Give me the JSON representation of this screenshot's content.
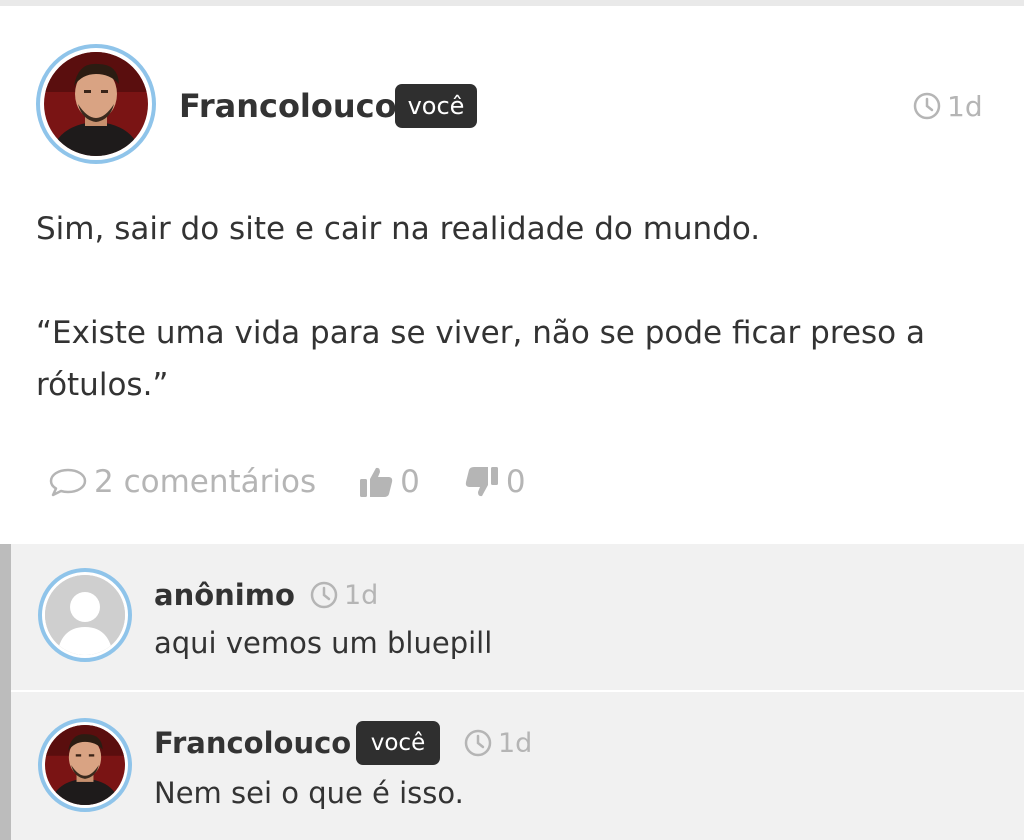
{
  "post": {
    "author": "Francolouco",
    "badge": "você",
    "time": "1d",
    "paragraphs": [
      "Sim, sair do site e cair na realidade do mundo.",
      "“Existe uma vida para se viver, não se pode ficar preso a rótulos.”"
    ],
    "comments_label": "2 comentários",
    "likes": "0",
    "dislikes": "0"
  },
  "comments": [
    {
      "author": "anônimo",
      "time": "1d",
      "text": "aqui vemos um bluepill"
    },
    {
      "author": "Francolouco",
      "badge": "você",
      "time": "1d",
      "text": "Nem sei o que é isso."
    }
  ],
  "icons": {
    "time": "clock-icon",
    "comments": "speech-bubble-icon",
    "like": "thumbs-up-icon",
    "dislike": "thumbs-down-icon"
  },
  "colors": {
    "avatar_ring": "#8fc4ea",
    "badge_bg": "#2f2f2f",
    "muted_text": "#b5b5b5",
    "comments_bg": "#f1f1f1",
    "thread_bar": "#bcbcbc"
  }
}
